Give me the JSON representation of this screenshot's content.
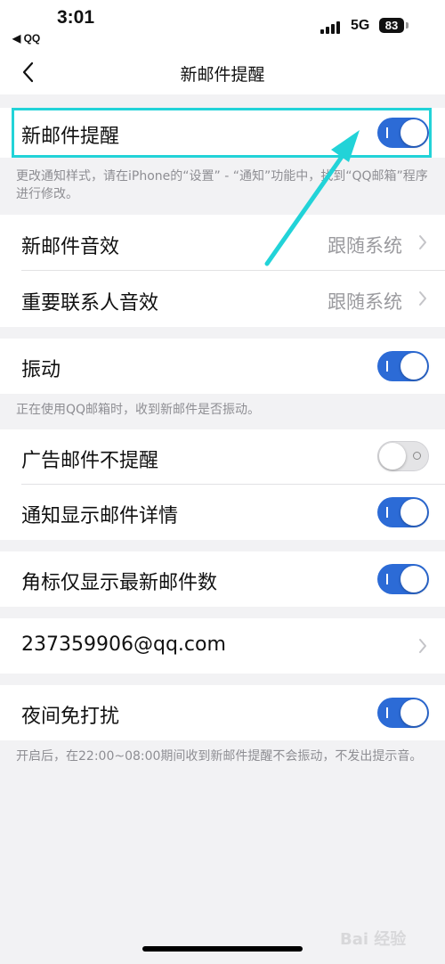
{
  "status_bar": {
    "time": "3:01",
    "back_app": "◀ QQ",
    "network": "5G",
    "battery": "83"
  },
  "nav": {
    "title": "新邮件提醒"
  },
  "sections": {
    "new_mail": {
      "label": "新邮件提醒",
      "toggle": "on",
      "note": "更改通知样式，请在iPhone的“设置” - “通知”功能中，找到“QQ邮箱”程序进行修改。"
    },
    "sound": {
      "items": [
        {
          "label": "新邮件音效",
          "value": "跟随系统"
        },
        {
          "label": "重要联系人音效",
          "value": "跟随系统"
        }
      ]
    },
    "vibrate": {
      "label": "振动",
      "toggle": "on",
      "note": "正在使用QQ邮箱时，收到新邮件是否振动。"
    },
    "ads": {
      "items": [
        {
          "label": "广告邮件不提醒",
          "toggle": "off"
        },
        {
          "label": "通知显示邮件详情",
          "toggle": "on"
        }
      ]
    },
    "badge": {
      "label": "角标仅显示最新邮件数",
      "toggle": "on"
    },
    "account": {
      "email": "237359906@qq.com"
    },
    "dnd": {
      "label": "夜间免打扰",
      "toggle": "on",
      "note": "开启后，在22:00~08:00期间收到新邮件提醒不会振动，不发出提示音。"
    }
  },
  "watermark": "Bai 经验",
  "colors": {
    "toggle_on": "#2c6bd6",
    "highlight": "#22d3d8",
    "background": "#f2f2f4"
  }
}
